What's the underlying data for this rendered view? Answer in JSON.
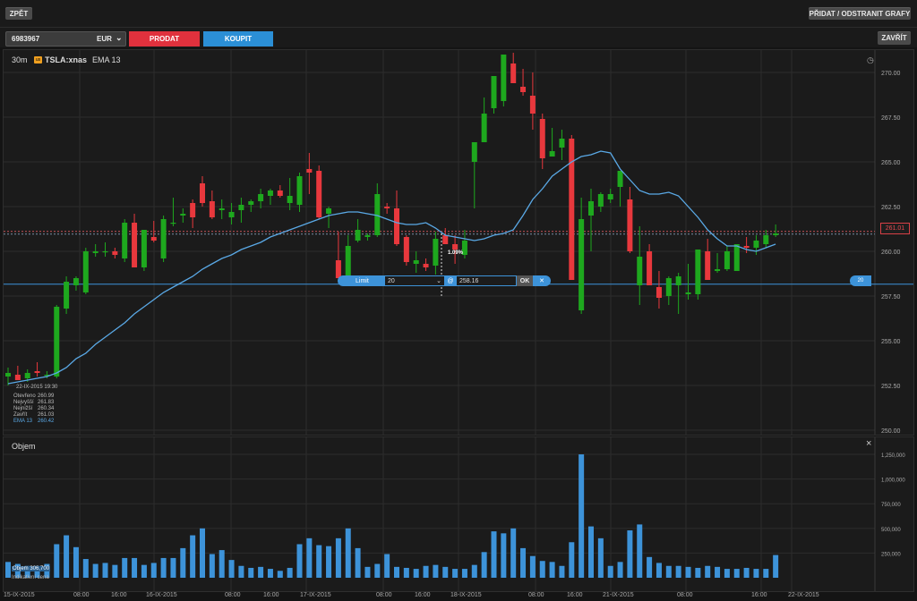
{
  "toolbar": {
    "back_label": "ZPĚT",
    "charts_label": "PŘIDAT / ODSTRANIT GRAFY",
    "close_label": "ZAVŘÍT"
  },
  "trade": {
    "account": "6983967",
    "currency": "EUR",
    "sell_label": "PRODAT",
    "buy_label": "KOUPIT"
  },
  "chart": {
    "timeframe": "30m",
    "symbol": "TSLA:xnas",
    "indicator": "EMA 13",
    "symbol_badge": "us",
    "current_price_label": "261.01",
    "hover_pct": "1.09%",
    "volume_title": "Objem",
    "volume_readout": "Objem 306,700",
    "indicative": "Indikativní cena"
  },
  "ohlc": {
    "datetime": "22-IX-2015 19:30",
    "rows": [
      {
        "label": "Otevřeno",
        "value": "260.99"
      },
      {
        "label": "Nejvyšší",
        "value": "261.83"
      },
      {
        "label": "Nejnižší",
        "value": "260.34"
      },
      {
        "label": "Zavřít",
        "value": "261.03"
      },
      {
        "label": "EMA 13",
        "value": "260.42"
      }
    ]
  },
  "order": {
    "type": "Limit",
    "quantity": "20",
    "at": "@",
    "price": "258.16",
    "ok": "OK",
    "close": "✕",
    "qty_badge": "20"
  },
  "colors": {
    "up": "#1ea81e",
    "down": "#e8383d",
    "ema": "#5aa9e6",
    "volume": "#3d93d9",
    "order_line": "#3d93d9"
  },
  "price_axis": {
    "ticks": [
      "270.00",
      "267.50",
      "265.00",
      "262.50",
      "260.00",
      "257.50",
      "255.00",
      "252.50",
      "250.00"
    ]
  },
  "volume_axis": {
    "ticks": [
      "1,250,000",
      "1,000,000",
      "750,000",
      "500,000",
      "250,000"
    ]
  },
  "time_axis": {
    "ticks": [
      "15-IX-2015",
      "08:00",
      "16:00",
      "16-IX-2015",
      "08:00",
      "16:00",
      "17-IX-2015",
      "08:00",
      "16:00",
      "18-IX-2015",
      "08:00",
      "16:00",
      "21-IX-2015",
      "08:00",
      "16:00",
      "22-IX-2015",
      "08:00",
      "16:00"
    ]
  },
  "chart_data": {
    "type": "candlestick",
    "ylim": [
      250,
      271
    ],
    "candles": [
      [
        253.0,
        253.5,
        252.5,
        253.2
      ],
      [
        253.1,
        253.6,
        252.8,
        252.8
      ],
      [
        252.9,
        253.4,
        252.7,
        253.2
      ],
      [
        253.3,
        253.8,
        253.0,
        253.2
      ],
      [
        253.1,
        253.3,
        252.9,
        253.1
      ],
      [
        253.0,
        257.0,
        252.9,
        256.9
      ],
      [
        256.8,
        258.6,
        256.5,
        258.3
      ],
      [
        258.1,
        258.6,
        257.8,
        258.5
      ],
      [
        257.7,
        260.2,
        257.6,
        260.0
      ],
      [
        259.9,
        260.4,
        259.7,
        260.0
      ],
      [
        260.0,
        260.5,
        259.7,
        260.0
      ],
      [
        260.0,
        260.2,
        259.6,
        259.8
      ],
      [
        259.6,
        261.8,
        259.4,
        261.6
      ],
      [
        261.6,
        262.1,
        259.2,
        259.1
      ],
      [
        259.1,
        261.2,
        258.9,
        261.2
      ],
      [
        260.8,
        261.7,
        260.5,
        260.6
      ],
      [
        259.6,
        262.0,
        259.4,
        261.8
      ],
      [
        261.6,
        263.0,
        261.4,
        261.6
      ],
      [
        262.0,
        262.4,
        261.6,
        262.1
      ],
      [
        262.7,
        262.9,
        261.3,
        261.9
      ],
      [
        263.8,
        264.2,
        262.5,
        262.7
      ],
      [
        262.8,
        263.4,
        261.8,
        261.9
      ],
      [
        262.3,
        262.9,
        261.8,
        262.4
      ],
      [
        261.9,
        262.7,
        261.5,
        262.2
      ],
      [
        262.3,
        263.0,
        261.6,
        262.6
      ],
      [
        262.6,
        262.9,
        262.2,
        262.8
      ],
      [
        262.8,
        263.5,
        262.4,
        263.2
      ],
      [
        263.1,
        263.5,
        262.6,
        263.4
      ],
      [
        263.4,
        263.7,
        263.0,
        263.1
      ],
      [
        262.7,
        264.1,
        262.3,
        263.1
      ],
      [
        262.6,
        264.4,
        262.2,
        264.2
      ],
      [
        264.6,
        265.5,
        263.2,
        264.4
      ],
      [
        264.5,
        264.8,
        261.8,
        261.9
      ],
      [
        262.1,
        262.5,
        261.3,
        262.4
      ],
      [
        259.5,
        261.1,
        259.1,
        258.5
      ],
      [
        258.6,
        260.9,
        258.3,
        260.3
      ],
      [
        260.6,
        261.8,
        260.5,
        261.2
      ],
      [
        260.8,
        261.0,
        260.6,
        260.9
      ],
      [
        260.9,
        263.8,
        260.8,
        263.2
      ],
      [
        262.5,
        262.7,
        262.1,
        262.4
      ],
      [
        262.4,
        263.4,
        260.3,
        260.4
      ],
      [
        260.8,
        260.9,
        259.2,
        259.4
      ],
      [
        259.3,
        260.0,
        258.8,
        259.5
      ],
      [
        259.3,
        259.6,
        258.9,
        259.1
      ],
      [
        259.2,
        261.1,
        258.7,
        260.7
      ],
      [
        260.9,
        261.3,
        260.5,
        260.4
      ],
      [
        260.4,
        260.9,
        259.3,
        260.1
      ],
      [
        259.8,
        261.2,
        259.6,
        260.6
      ],
      [
        265.0,
        265.6,
        262.4,
        266.1
      ],
      [
        266.1,
        268.6,
        266.3,
        267.7
      ],
      [
        268.0,
        269.8,
        267.7,
        269.8
      ],
      [
        268.4,
        270.4,
        268.1,
        271.0
      ],
      [
        270.5,
        271.1,
        269.8,
        269.4
      ],
      [
        269.2,
        270.2,
        268.7,
        268.9
      ],
      [
        268.7,
        270.0,
        266.8,
        267.7
      ],
      [
        267.4,
        267.7,
        264.6,
        265.2
      ],
      [
        265.3,
        266.9,
        265.3,
        265.6
      ],
      [
        265.8,
        266.8,
        265.1,
        266.3
      ],
      [
        266.3,
        266.5,
        259.5,
        258.4
      ],
      [
        256.7,
        263.0,
        256.5,
        261.8
      ],
      [
        262.0,
        263.5,
        260.0,
        262.8
      ],
      [
        262.5,
        263.3,
        262.2,
        263.2
      ],
      [
        262.9,
        263.5,
        262.7,
        263.2
      ],
      [
        263.6,
        264.3,
        262.5,
        264.5
      ],
      [
        262.9,
        263.6,
        259.9,
        260.0
      ],
      [
        258.1,
        261.4,
        257.0,
        259.7
      ],
      [
        260.0,
        260.4,
        258.1,
        258.1
      ],
      [
        258.0,
        258.9,
        256.8,
        257.4
      ],
      [
        257.5,
        258.6,
        257.0,
        258.5
      ],
      [
        258.1,
        258.8,
        256.5,
        258.6
      ],
      [
        257.6,
        259.3,
        257.3,
        257.7
      ],
      [
        257.6,
        259.8,
        257.3,
        260.1
      ],
      [
        260.0,
        260.7,
        258.4,
        258.4
      ],
      [
        258.9,
        259.9,
        258.8,
        259.0
      ],
      [
        259.0,
        260.3,
        258.9,
        260.0
      ],
      [
        258.9,
        260.4,
        258.9,
        260.4
      ],
      [
        260.3,
        260.8,
        259.9,
        260.2
      ],
      [
        260.2,
        260.9,
        259.8,
        260.6
      ],
      [
        260.4,
        261.2,
        260.2,
        260.9
      ],
      [
        260.9,
        261.5,
        260.8,
        261.0
      ]
    ],
    "ema": [
      252.6,
      252.7,
      252.8,
      252.9,
      253.0,
      253.2,
      253.5,
      254.0,
      254.3,
      254.8,
      255.2,
      255.6,
      256.0,
      256.5,
      256.9,
      257.3,
      257.7,
      258.0,
      258.3,
      258.6,
      259.0,
      259.3,
      259.6,
      259.8,
      260.1,
      260.3,
      260.5,
      260.8,
      261.0,
      261.2,
      261.4,
      261.6,
      261.8,
      262.0,
      262.1,
      262.2,
      262.2,
      262.1,
      262.0,
      261.8,
      261.6,
      261.5,
      261.5,
      261.6,
      261.3,
      260.9,
      260.8,
      260.7,
      260.6,
      260.7,
      260.9,
      261.0,
      261.2,
      262.0,
      262.9,
      263.5,
      264.2,
      264.6,
      265.0,
      265.3,
      265.4,
      265.6,
      265.5,
      264.6,
      264.0,
      263.4,
      263.2,
      263.2,
      263.3,
      263.1,
      262.5,
      261.9,
      261.2,
      260.7,
      260.3,
      260.3,
      260.1,
      260.0,
      260.2,
      260.4
    ],
    "volume": [
      160000,
      140000,
      120000,
      120000,
      140000,
      340000,
      430000,
      310000,
      190000,
      140000,
      150000,
      130000,
      200000,
      200000,
      130000,
      150000,
      200000,
      200000,
      300000,
      430000,
      500000,
      240000,
      280000,
      180000,
      120000,
      100000,
      110000,
      90000,
      70000,
      100000,
      340000,
      400000,
      330000,
      320000,
      400000,
      500000,
      300000,
      110000,
      140000,
      240000,
      110000,
      100000,
      90000,
      120000,
      130000,
      110000,
      90000,
      90000,
      130000,
      260000,
      470000,
      450000,
      500000,
      300000,
      220000,
      170000,
      160000,
      120000,
      360000,
      1250000,
      520000,
      400000,
      120000,
      160000,
      480000,
      540000,
      210000,
      150000,
      120000,
      120000,
      110000,
      100000,
      120000,
      110000,
      90000,
      90000,
      100000,
      90000,
      90000,
      230000
    ]
  }
}
